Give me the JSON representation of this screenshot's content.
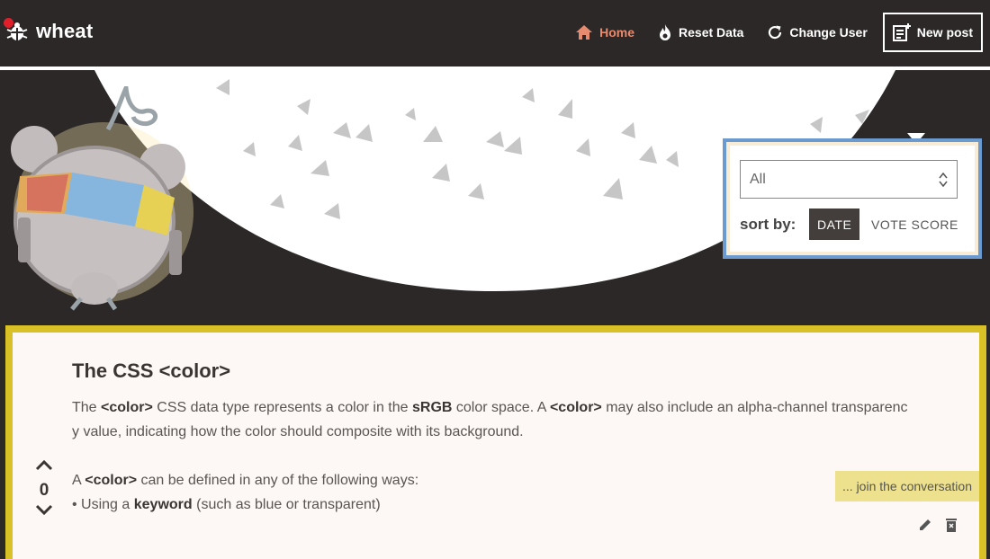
{
  "app": {
    "name": "wheat"
  },
  "nav": {
    "home": "Home",
    "reset": "Reset Data",
    "change_user": "Change User",
    "new_post": "New post"
  },
  "filter": {
    "selected": "All",
    "sort_label": "sort by:",
    "sort_date": "DATE",
    "sort_vote": "VOTE SCORE"
  },
  "post": {
    "title": "The CSS <color>",
    "p1_a": "The ",
    "p1_b": "<color>",
    "p1_c": " CSS data type represents a color in the ",
    "p1_d": "sRGB",
    "p1_e": " color space. A ",
    "p1_f": "<color>",
    "p1_g": " may also include an alpha-channel transparenc",
    "p1_h": "y value, indicating how the color should composite with its background.",
    "p2_a": "A ",
    "p2_b": "<color>",
    "p2_c": " can be defined in any of the following ways:",
    "p3_a": "• Using a ",
    "p3_b": "keyword",
    "p3_c": " (such as blue or transparent)",
    "score": "0",
    "join": "... join the conversation"
  },
  "colors": {
    "background": "#2c2827",
    "accent": "#e88a6e",
    "post_border": "#d9c027",
    "filter_border": "#6a9ad0",
    "join_bg": "#ede18d"
  }
}
